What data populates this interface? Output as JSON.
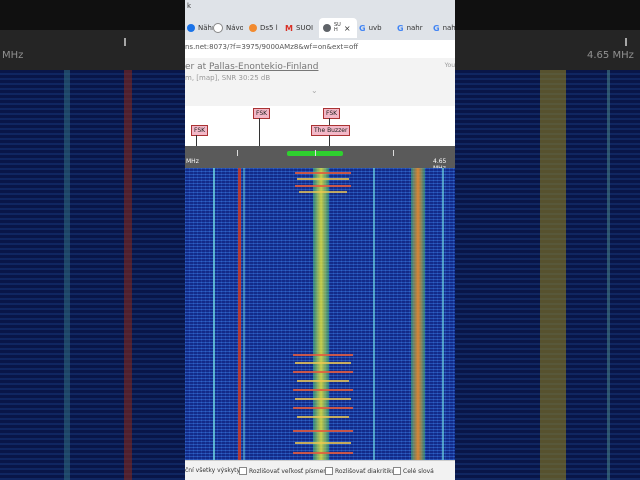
{
  "browser": {
    "window_title": "k",
    "tabs": [
      {
        "label": "Nähr",
        "icon": "web-icon",
        "color": "#1a73e8"
      },
      {
        "label": "Návo",
        "icon": "web-icon",
        "color": "#888888"
      },
      {
        "label": "Ds5 l",
        "icon": "web-icon",
        "color": "#f28b30"
      },
      {
        "label": "SUOI",
        "icon": "gmail-icon",
        "color": "#d93025"
      },
      {
        "label": "SU\nH",
        "icon": "web-icon",
        "color": "#5f6368",
        "active": true
      },
      {
        "label": "uvb",
        "icon": "google-icon",
        "color": "#4285f4"
      },
      {
        "label": "nahr",
        "icon": "google-icon",
        "color": "#4285f4"
      },
      {
        "label": "nah",
        "icon": "google-icon",
        "color": "#4285f4"
      }
    ],
    "url": "ns.net:8073/?f=3975/9000AMz8&wf=on&ext=off"
  },
  "receiver": {
    "title_prefix": "er at ",
    "title_location": "Pallas-Enontekio-Finland",
    "subtitle": "m, [map], SNR 30:25 dB",
    "aside": "You"
  },
  "spectrum": {
    "markers": [
      "FSK",
      "FSK",
      "FSK",
      "The Buzzer"
    ],
    "freq_left": "MHz",
    "freq_right": "4.65 MHz"
  },
  "side_panels": {
    "left_label": "MHz",
    "right_label": "4.65 MHz"
  },
  "find_bar": {
    "highlight_all": "ční všetky výskyty",
    "match_case": "Rozlišovať veľkosť písmen",
    "match_diacritics": "Rozlišovať diakritiku",
    "whole_words": "Celé slová"
  },
  "colors": {
    "waterfall_bg": "#1c3ea8",
    "passband": "#2fd02f",
    "marker_bg": "#f3b8c8"
  }
}
